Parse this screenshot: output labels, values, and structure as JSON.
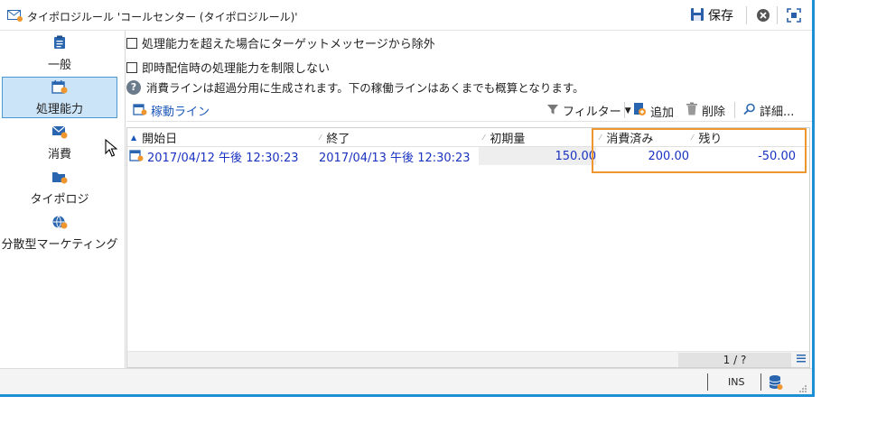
{
  "window": {
    "title": "タイポロジルール 'コールセンター (タイポロジルール)'",
    "save_label": "保存",
    "accent": "#1e8fd4"
  },
  "sidebar": {
    "items": [
      {
        "label": "一般",
        "icon": "clipboard-icon"
      },
      {
        "label": "処理能力",
        "icon": "calendar-capacity-icon",
        "active": true
      },
      {
        "label": "消費",
        "icon": "envelope-star-icon"
      },
      {
        "label": "タイポロジ",
        "icon": "folder-star-icon"
      },
      {
        "label": "分散型マーケティング",
        "icon": "globe-people-icon"
      }
    ]
  },
  "options": {
    "exclude_target": "処理能力を超えた場合にターゲットメッセージから除外",
    "no_limit_instant": "即時配信時の処理能力を制限しない",
    "info_text": "消費ラインは超過分用に生成されます。下の稼働ラインはあくまでも概算となります。"
  },
  "toolbar": {
    "schedule_label": "稼動ライン",
    "filter_label": "フィルター",
    "add_label": "追加",
    "delete_label": "削除",
    "detail_label": "詳細..."
  },
  "grid": {
    "columns": [
      "開始日",
      "終了",
      "初期量",
      "消費済み",
      "残り"
    ],
    "rows": [
      {
        "start": "2017/04/12 午後 12:30:23",
        "end": "2017/04/13 午後 12:30:23",
        "initial": "150.00",
        "consumed": "200.00",
        "remaining": "-50.00"
      }
    ],
    "pager": "1 / ?"
  },
  "status": {
    "ins": "INS"
  },
  "colors": {
    "highlight": "#f0962f",
    "link": "#1a56b8",
    "row_text": "#1a33c0",
    "sidebar_active": "#cce4f7"
  }
}
